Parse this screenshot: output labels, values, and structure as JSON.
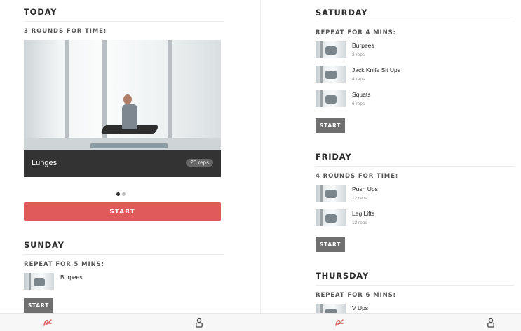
{
  "left": {
    "today_title": "TODAY",
    "today_subtitle": "3 ROUNDS FOR TIME:",
    "hero": {
      "exercise": "Lunges",
      "reps": "20 reps"
    },
    "start_label": "START",
    "sunday": {
      "title": "SUNDAY",
      "subtitle": "REPEAT FOR 5 MINS:",
      "exercises": [
        {
          "name": "Burpees"
        }
      ],
      "start_label": "START"
    }
  },
  "right": {
    "saturday": {
      "title": "SATURDAY",
      "subtitle": "REPEAT FOR 4 MINS:",
      "exercises": [
        {
          "name": "Burpees",
          "reps": "2 reps"
        },
        {
          "name": "Jack Knife Sit Ups",
          "reps": "4 reps"
        },
        {
          "name": "Squats",
          "reps": "6 reps"
        }
      ],
      "start_label": "START"
    },
    "friday": {
      "title": "FRIDAY",
      "subtitle": "4 ROUNDS FOR TIME:",
      "exercises": [
        {
          "name": "Push Ups",
          "reps": "12 reps"
        },
        {
          "name": "Leg Lifts",
          "reps": "12 reps"
        }
      ],
      "start_label": "START"
    },
    "thursday": {
      "title": "THURSDAY",
      "subtitle": "REPEAT FOR 6 MINS:",
      "exercises": [
        {
          "name": "V Ups"
        }
      ]
    }
  },
  "carousel": {
    "count": 2,
    "active": 0
  },
  "colors": {
    "accent": "#e05a5b",
    "button_gray": "#6f6f6f",
    "caption_bg": "#333333"
  },
  "tabbar": {
    "icons": [
      "workout-logo-icon",
      "user-icon",
      "workout-logo-icon",
      "user-icon"
    ]
  }
}
